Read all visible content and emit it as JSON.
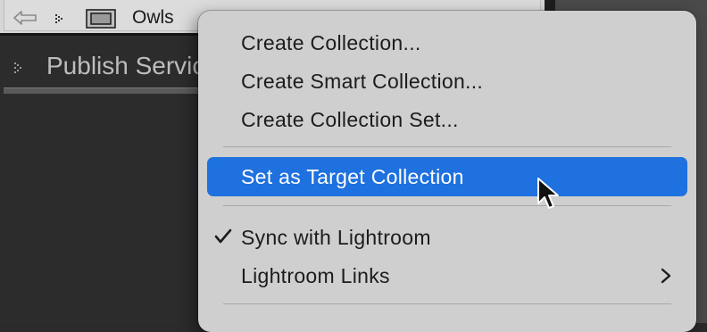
{
  "collections_panel": {
    "collection_name": "Owls",
    "section_label": "Publish Servic"
  },
  "context_menu": {
    "items": [
      {
        "label": "Create Collection..."
      },
      {
        "label": "Create Smart Collection..."
      },
      {
        "label": "Create Collection Set..."
      },
      {
        "label": "Set as Target Collection"
      },
      {
        "label": "Sync with Lightroom",
        "checked": true
      },
      {
        "label": "Lightroom Links",
        "has_submenu": true
      }
    ],
    "selected_index": 3
  },
  "colors": {
    "menu_background": "#cfcfcf",
    "selection": "#1e71df",
    "panel_background": "#2c2c2c"
  }
}
